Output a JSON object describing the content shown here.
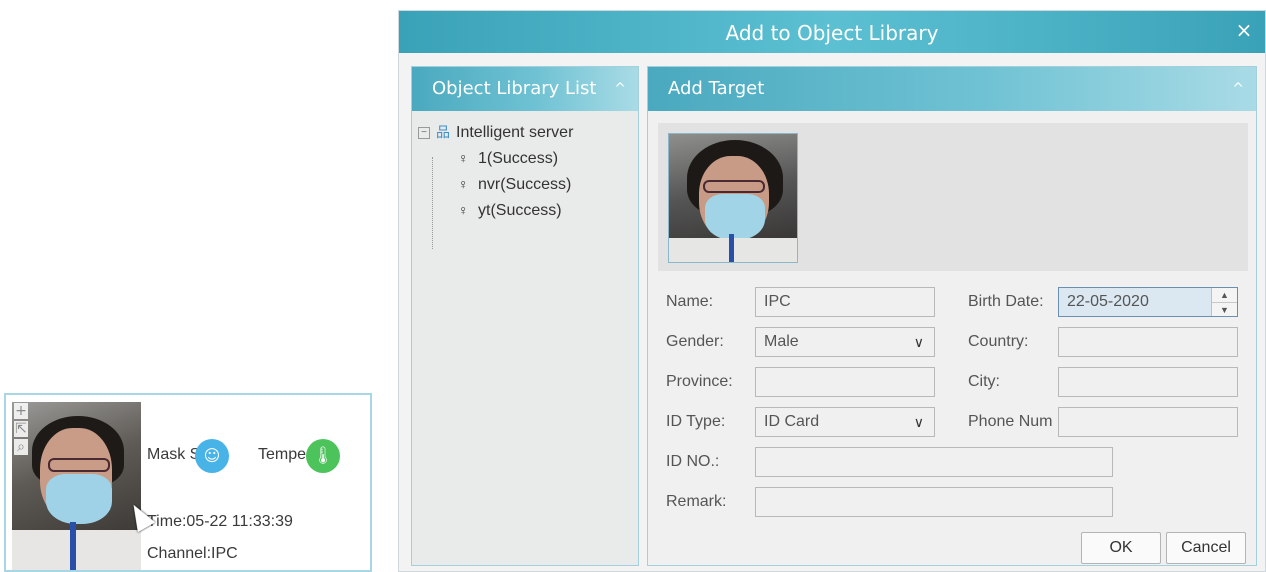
{
  "snapshot": {
    "tools": [
      "+",
      "⇱",
      "⌕"
    ],
    "mask_label": "Mask Status",
    "temp_label": "Temperature",
    "mask_badge_glyph": "☺",
    "temp_badge_glyph": "🌡",
    "time": "Time:05-22 11:33:39",
    "channel": "Channel:IPC"
  },
  "dialog": {
    "title": "Add to Object Library",
    "close_glyph": "×",
    "library_panel": {
      "title": "Object Library List",
      "caret": "^",
      "tree": {
        "root": "Intelligent server",
        "toggle": "⊟",
        "children": [
          "1(Success)",
          "nvr(Success)",
          "yt(Success)"
        ]
      }
    },
    "target_panel": {
      "title": "Add Target",
      "caret": "^",
      "form": {
        "name_label": "Name:",
        "name_value": "IPC",
        "birth_label": "Birth Date:",
        "birth_value": "22-05-2020",
        "gender_label": "Gender:",
        "gender_value": "Male",
        "country_label": "Country:",
        "country_value": "",
        "province_label": "Province:",
        "province_value": "",
        "city_label": "City:",
        "city_value": "",
        "idtype_label": "ID Type:",
        "idtype_value": "ID Card",
        "phone_label": "Phone Num",
        "phone_value": "",
        "idno_label": "ID NO.:",
        "idno_value": "",
        "remark_label": "Remark:",
        "remark_value": ""
      },
      "ok_label": "OK",
      "cancel_label": "Cancel"
    }
  },
  "colors": {
    "title_bar": "#3aa2b8",
    "panel_head": "#4aa9bf",
    "mask_badge": "#48b3e6",
    "temp_badge": "#4cc35b"
  }
}
